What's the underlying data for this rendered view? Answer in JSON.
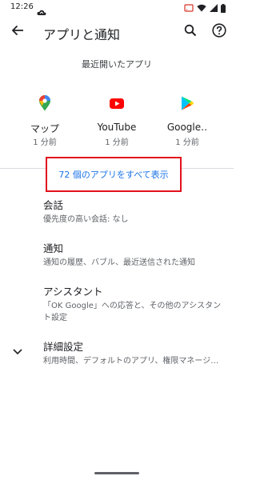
{
  "status_bar": {
    "time": "12:26",
    "left_icon": "cloud-icon",
    "right_icons": [
      "cast-icon",
      "wifi-icon",
      "signal-icon",
      "battery-icon"
    ]
  },
  "app_bar": {
    "title": "アプリと通知",
    "back_icon": "arrow-back-icon",
    "search_icon": "search-icon",
    "help_icon": "help-icon"
  },
  "recent": {
    "header": "最近開いたアプリ",
    "apps": [
      {
        "name": "マップ",
        "time": "1 分前",
        "icon": "maps-icon"
      },
      {
        "name": "YouTube",
        "time": "1 分前",
        "icon": "youtube-icon"
      },
      {
        "name": "Google‥",
        "time": "1 分前",
        "icon": "play-store-icon"
      }
    ],
    "see_all": "72 個のアプリをすべて表示"
  },
  "preferences": [
    {
      "title": "会話",
      "summary": "優先度の高い会話: なし"
    },
    {
      "title": "通知",
      "summary": "通知の履歴、バブル、最近送信された通知"
    },
    {
      "title": "アシスタント",
      "summary": "「OK Google」への応答と、その他のアシスタント設定"
    },
    {
      "title": "詳細設定",
      "summary": "利用時間、デフォルトのアプリ、権限マネージ…",
      "icon": "chevron-down-icon"
    }
  ],
  "colors": {
    "accent": "#1a73e8",
    "highlight_box": "#e2111c",
    "text_primary": "#202124",
    "text_secondary": "#5f6368"
  }
}
